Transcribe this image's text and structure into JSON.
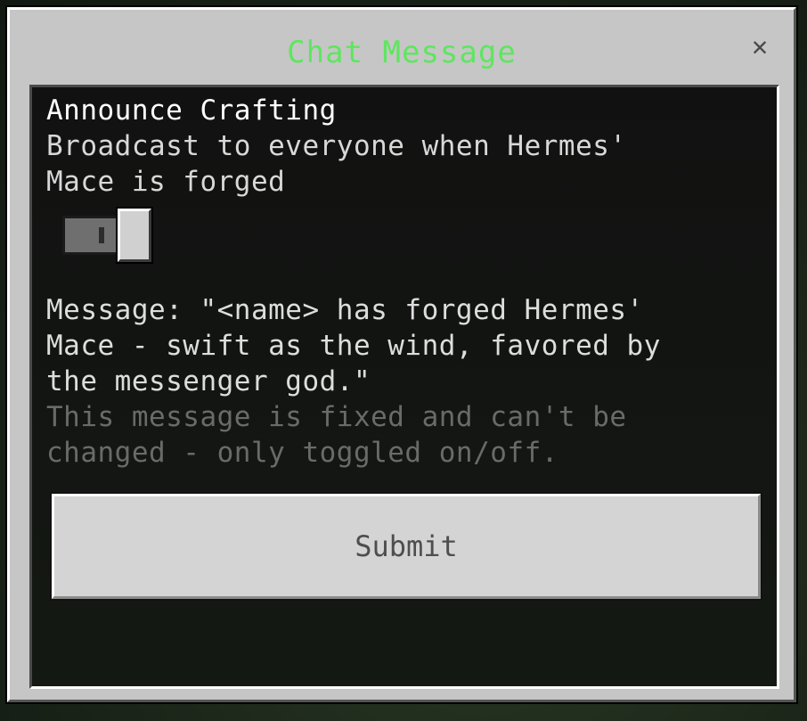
{
  "dialog": {
    "title": "Chat Message",
    "close_glyph": "✕",
    "close_icon": "close-icon"
  },
  "setting": {
    "heading": "Announce Crafting",
    "description": "Broadcast to everyone when Hermes'\nMace is forged",
    "toggle_on": true
  },
  "message": {
    "text": "Message: \"<name> has forged Hermes'\nMace - swift as the wind, favored by\nthe messenger god.\"",
    "note": "This message is fixed and can't be\nchanged - only toggled on/off."
  },
  "actions": {
    "submit_label": "Submit"
  },
  "colors": {
    "title": "#5ee65e",
    "panel": "#c6c6c6",
    "content_bg": "#141414"
  }
}
